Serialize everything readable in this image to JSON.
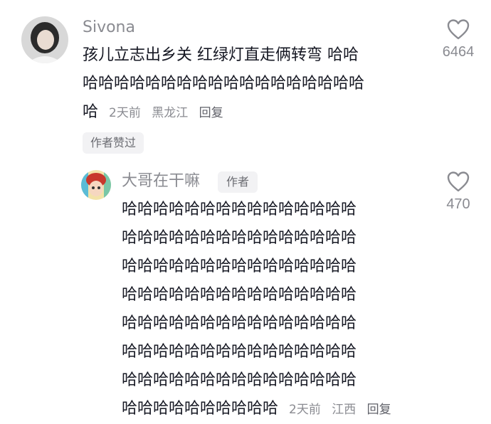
{
  "comments": [
    {
      "username": "Sivona",
      "lines": [
        "孩儿立志出乡关  红绿灯直走俩转弯  哈哈",
        "哈哈哈哈哈哈哈哈哈哈哈哈哈哈哈哈哈哈",
        "哈"
      ],
      "time": "2天前",
      "location": "黑龙江",
      "reply_label": "回复",
      "like_count": "6464",
      "liked_badge": "作者赞过"
    },
    {
      "username": "大哥在干嘛",
      "author_tag": "作者",
      "lines": [
        "哈哈哈哈哈哈哈哈哈哈哈哈哈哈哈",
        "哈哈哈哈哈哈哈哈哈哈哈哈哈哈哈",
        "哈哈哈哈哈哈哈哈哈哈哈哈哈哈哈",
        "哈哈哈哈哈哈哈哈哈哈哈哈哈哈哈",
        "哈哈哈哈哈哈哈哈哈哈哈哈哈哈哈",
        "哈哈哈哈哈哈哈哈哈哈哈哈哈哈哈",
        "哈哈哈哈哈哈哈哈哈哈哈哈哈哈哈",
        "哈哈哈哈哈哈哈哈哈哈"
      ],
      "time": "2天前",
      "location": "江西",
      "reply_label": "回复",
      "like_count": "470"
    }
  ],
  "icons": {
    "like": "heart-outline-icon",
    "avatar1": "user-photo-avatar",
    "avatar2": "cartoon-avatar"
  }
}
